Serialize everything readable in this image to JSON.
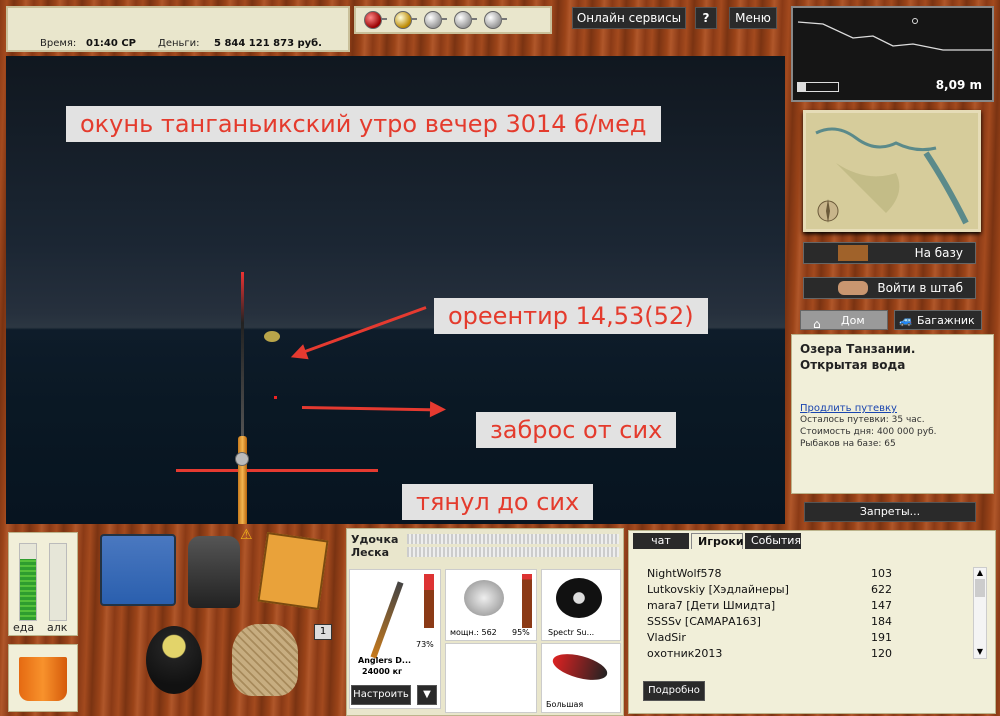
{
  "status": {
    "time_label": "Время:",
    "time_value": "01:40 СР",
    "money_label": "Деньги:",
    "money_value": "5 844 121 873 руб."
  },
  "top_buttons": {
    "online": "Онлайн сервисы",
    "help": "?",
    "menu": "Меню"
  },
  "depth": {
    "value": "8,09 m"
  },
  "annotations": {
    "fish": "окунь танганьикский утро вечер 3014 б/мед",
    "landmark": "ореентир 14,53(52)",
    "cast": "заброс от сих",
    "pull": "тянул до сих"
  },
  "right_panel": {
    "to_base": "На базу",
    "hq": "Войти в штаб",
    "home_tab": "Дом",
    "trunk_tab": "Багажник",
    "location_line1": "Озера Танзании.",
    "location_line2": "Открытая вода",
    "extend_link": "Продлить путевку",
    "remaining": "Осталось путевки: 35 час.",
    "cost": "Стоимость дня: 400 000 руб.",
    "fishers": "Рыбаков на базе: 65",
    "bans": "Запреты..."
  },
  "gauges": {
    "food_label": "еда",
    "alc_label": "алк",
    "food_level": 0.8,
    "alc_level": 0.0
  },
  "inventory": {
    "count_badge": "1"
  },
  "tackle": {
    "rod_label": "Удочка",
    "line_label": "Леска",
    "rod_name": "Anglers D...",
    "rod_weight": "24000 кг",
    "rod_percent": "73%",
    "reel_power": "мощн.: 562",
    "reel_percent": "95%",
    "line_name": "Spectr Su...",
    "lure_name": "Большая",
    "setup_button": "Настроить",
    "dropdown": "▼"
  },
  "chat": {
    "tabs": [
      "чат",
      "Игроки",
      "События"
    ],
    "active_tab": "Игроки",
    "players": [
      {
        "name": "NightWolf578",
        "score": "103"
      },
      {
        "name": "Lutkovskiy [Хэдлайнеры]",
        "score": "622"
      },
      {
        "name": "mara7 [Дети Шмидта]",
        "score": "147"
      },
      {
        "name": "SSSSv [САМАРА163]",
        "score": "184"
      },
      {
        "name": "VladSir",
        "score": "191"
      },
      {
        "name": "охотник2013",
        "score": "120"
      }
    ],
    "details_button": "Подробно"
  },
  "colors": {
    "annotation_red": "#e43b2d",
    "wood": "#8a3a16",
    "panel": "#f1efd9"
  }
}
